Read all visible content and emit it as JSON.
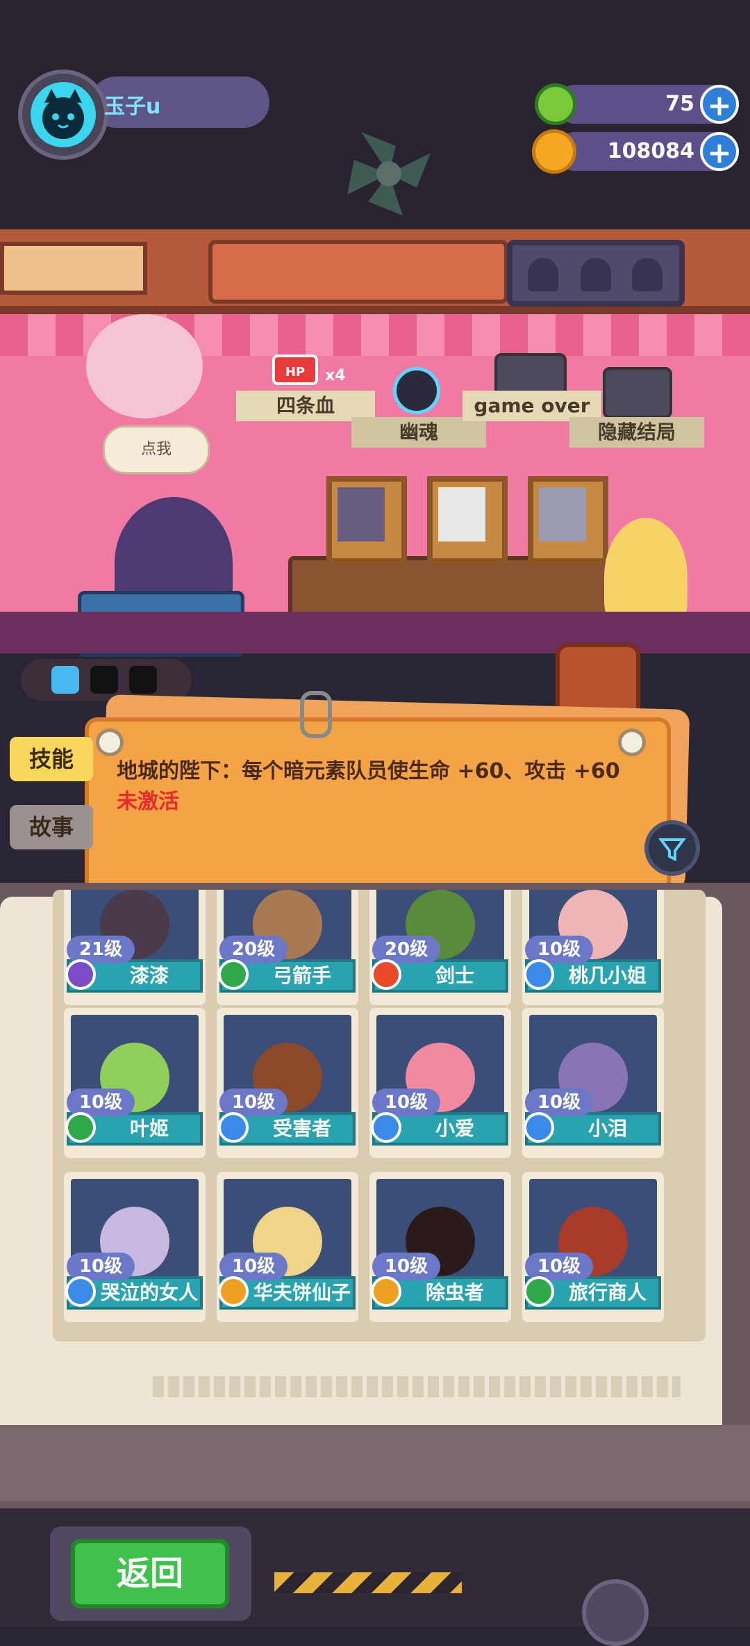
{
  "header": {
    "user_name": "玉子u",
    "gems": "75",
    "coins": "108084"
  },
  "shelf": {
    "flags": [
      "四条血",
      "幽魂",
      "game over",
      "隐藏结局"
    ],
    "hp_label": "HP",
    "hp_multiplier": "x4"
  },
  "room": {
    "speech": "点我"
  },
  "tabs": {
    "skill": "技能",
    "story": "故事"
  },
  "notice": {
    "text": "地城的陛下：每个暗元素队员使生命 +60、攻击 +60",
    "status": "未激活"
  },
  "heroes": [
    {
      "level": "21级",
      "name": "漆漆",
      "elem": "#7b4cc8",
      "face": "#4a3a4a"
    },
    {
      "level": "20级",
      "name": "弓箭手",
      "elem": "#2ea84a",
      "face": "#a87a52"
    },
    {
      "level": "20级",
      "name": "剑士",
      "elem": "#e84a2a",
      "face": "#5a8a3a"
    },
    {
      "level": "10级",
      "name": "桃几小姐",
      "elem": "#3a8ae8",
      "face": "#f0b6b6"
    },
    {
      "level": "10级",
      "name": "叶姬",
      "elem": "#2ea84a",
      "face": "#8fcf5a"
    },
    {
      "level": "10级",
      "name": "受害者",
      "elem": "#3a8ae8",
      "face": "#8a4a2a"
    },
    {
      "level": "10级",
      "name": "小爱",
      "elem": "#3a8ae8",
      "face": "#f08aa0"
    },
    {
      "level": "10级",
      "name": "小泪",
      "elem": "#3a8ae8",
      "face": "#8a74b8"
    },
    {
      "level": "10级",
      "name": "哭泣的女人",
      "elem": "#3a8ae8",
      "face": "#c8b8e0"
    },
    {
      "level": "10级",
      "name": "华夫饼仙子",
      "elem": "#f0a020",
      "face": "#f0d48a"
    },
    {
      "level": "10级",
      "name": "除虫者",
      "elem": "#f0a020",
      "face": "#2a1a1a"
    },
    {
      "level": "10级",
      "name": "旅行商人",
      "elem": "#2ea84a",
      "face": "#a83a2a"
    }
  ],
  "footer": {
    "back_label": "返回"
  },
  "colors": {
    "accent": "#f5a347",
    "card_band": "#2aa3b0",
    "back_button": "#3fc14b"
  }
}
